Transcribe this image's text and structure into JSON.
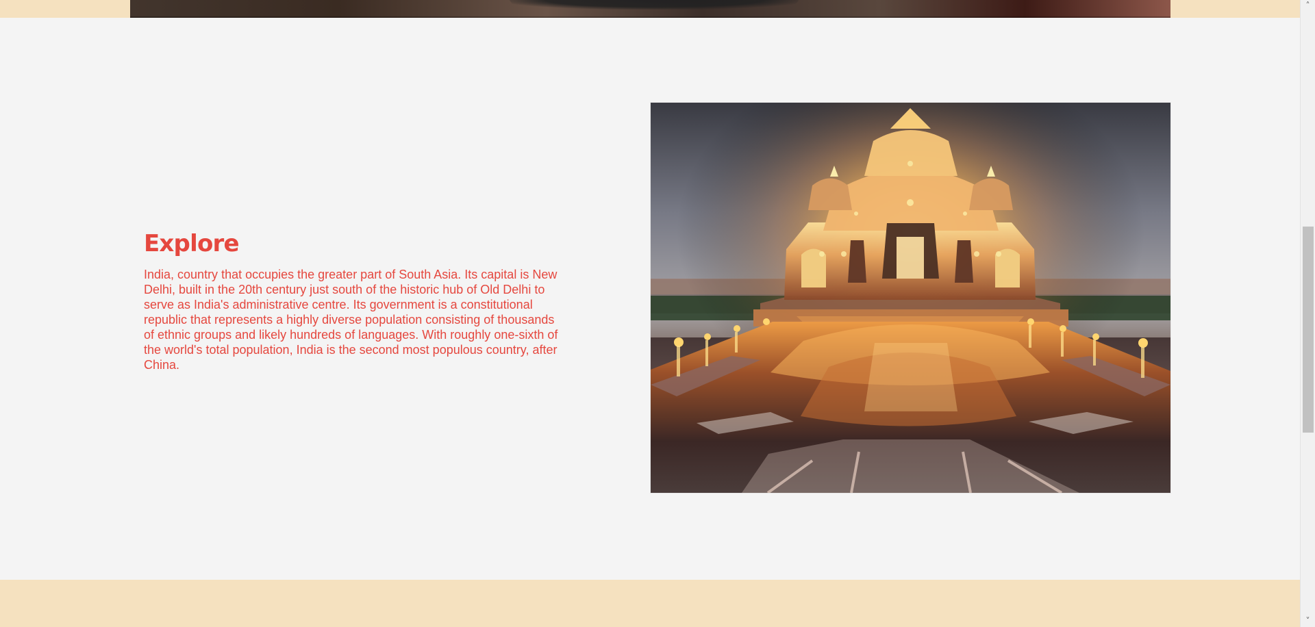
{
  "section": {
    "title": "Explore",
    "description": "India, country that occupies the greater part of South Asia. Its capital is New Delhi, built in the 20th century just south of the historic hub of Old Delhi to serve as India's administrative centre. Its government is a constitutional republic that represents a highly diverse population consisting of thousands of ethnic groups and likely hundreds of languages. With roughly one-sixth of the world's total population, India is the second most populous country, after China."
  },
  "colors": {
    "accent": "#e5473e",
    "content_background": "#f4f4f4",
    "band_background": "#f5e1bf",
    "scrollbar_thumb": "#c1c1c1"
  },
  "icons": {
    "scroll_up": "chevron-up-icon",
    "scroll_down": "chevron-down-icon"
  }
}
